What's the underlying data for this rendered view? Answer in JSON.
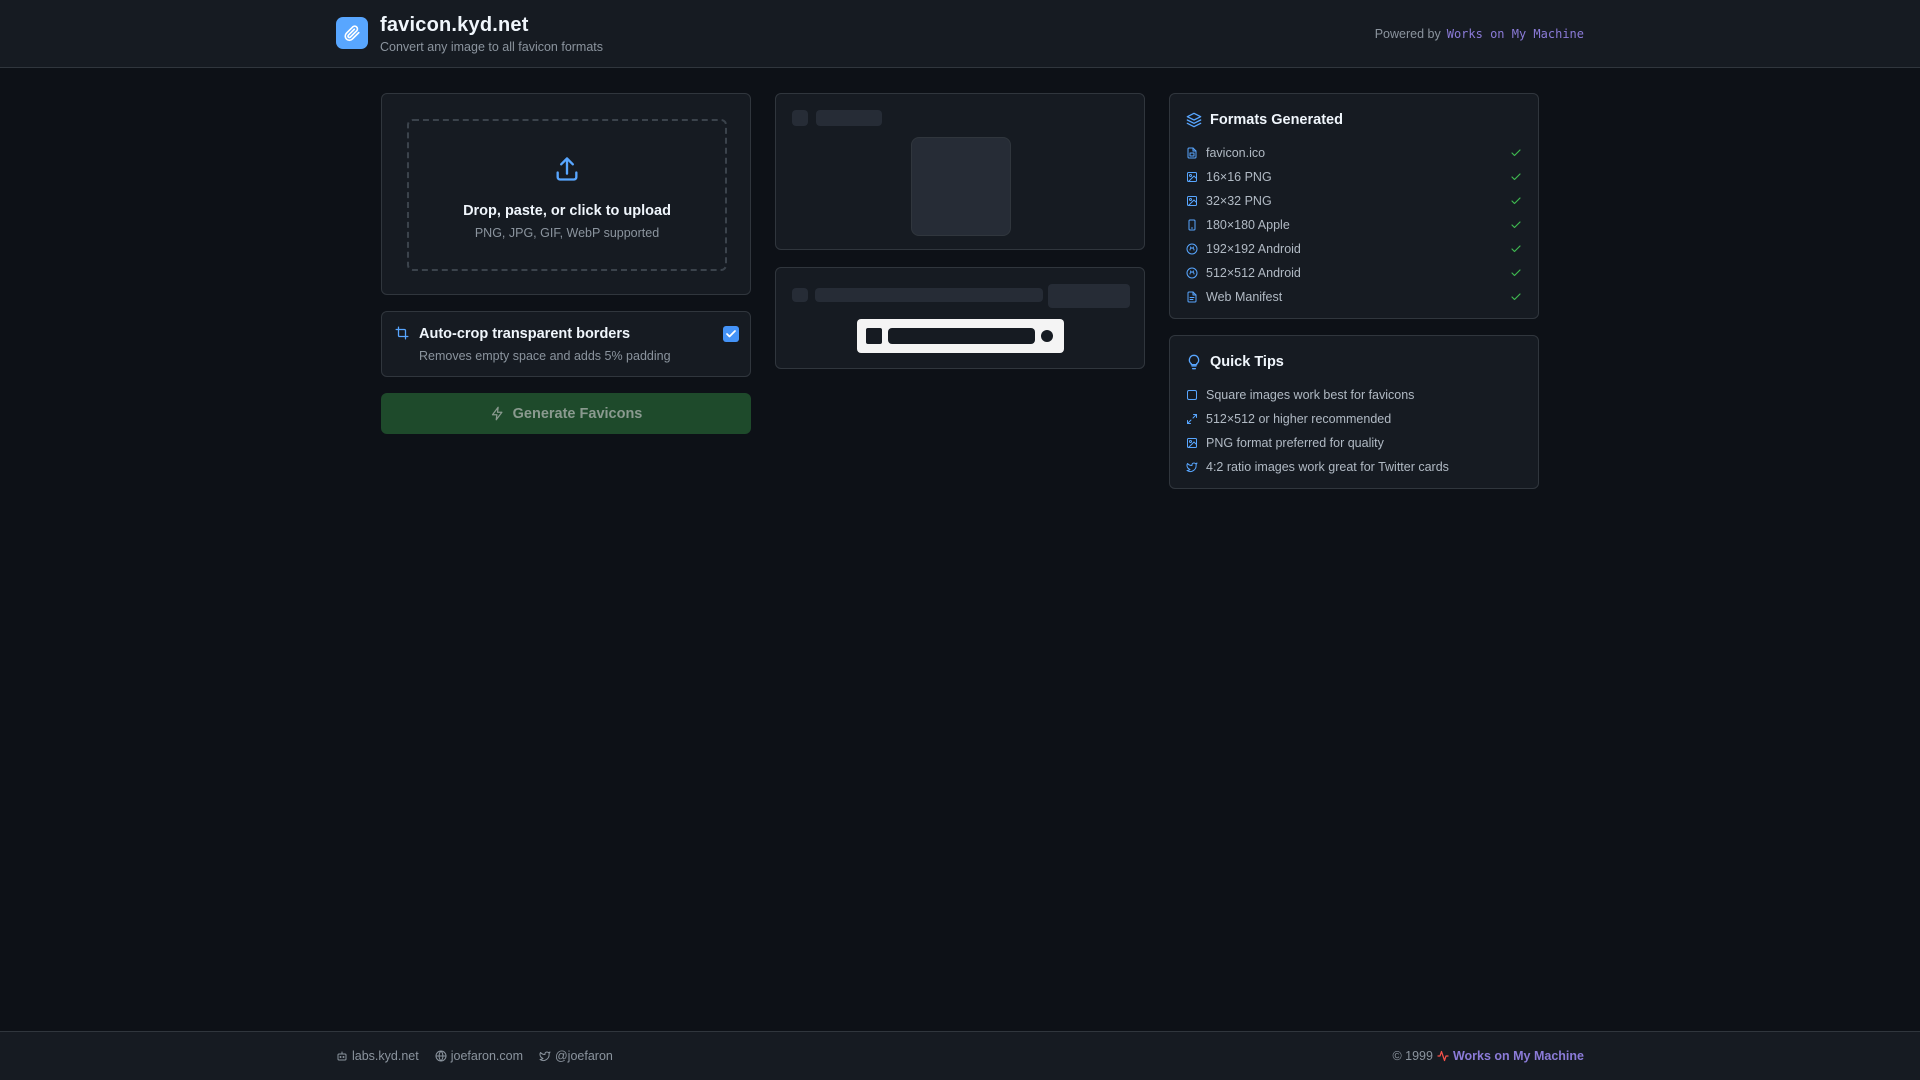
{
  "header": {
    "title": "favicon.kyd.net",
    "subtitle": "Convert any image to all favicon formats",
    "powered_prefix": "Powered by",
    "powered_link": "Works on My Machine"
  },
  "upload": {
    "title": "Drop, paste, or click to upload",
    "subtitle": "PNG, JPG, GIF, WebP supported"
  },
  "autocrop": {
    "title": "Auto-crop transparent borders",
    "subtitle": "Removes empty space and adds 5% padding",
    "checked": true
  },
  "generate_button": "Generate Favicons",
  "formats": {
    "title": "Formats Generated",
    "items": [
      {
        "label": "favicon.ico",
        "icon": "file-icon"
      },
      {
        "label": "16×16 PNG",
        "icon": "image-icon"
      },
      {
        "label": "32×32 PNG",
        "icon": "image-icon"
      },
      {
        "label": "180×180 Apple",
        "icon": "phone-icon"
      },
      {
        "label": "192×192 Android",
        "icon": "android-icon"
      },
      {
        "label": "512×512 Android",
        "icon": "android-icon"
      },
      {
        "label": "Web Manifest",
        "icon": "document-icon"
      }
    ]
  },
  "tips": {
    "title": "Quick Tips",
    "items": [
      {
        "label": "Square images work best for favicons",
        "icon": "square-icon"
      },
      {
        "label": "512×512 or higher recommended",
        "icon": "expand-icon"
      },
      {
        "label": "PNG format preferred for quality",
        "icon": "image-icon"
      },
      {
        "label": "4:2 ratio images work great for Twitter cards",
        "icon": "twitter-icon"
      }
    ]
  },
  "footer": {
    "links": [
      {
        "label": "labs.kyd.net",
        "icon": "robot-icon"
      },
      {
        "label": "joefaron.com",
        "icon": "globe-icon"
      },
      {
        "label": "@joefaron",
        "icon": "twitter-icon"
      }
    ],
    "copyright": "© 1999",
    "brand": "Works on My Machine"
  },
  "colors": {
    "background": "#0d1117",
    "card": "#161b22",
    "accent": "#58a6ff",
    "success": "#3fb950",
    "brand": "#8b7bd8",
    "button": "#1e4a2b"
  }
}
